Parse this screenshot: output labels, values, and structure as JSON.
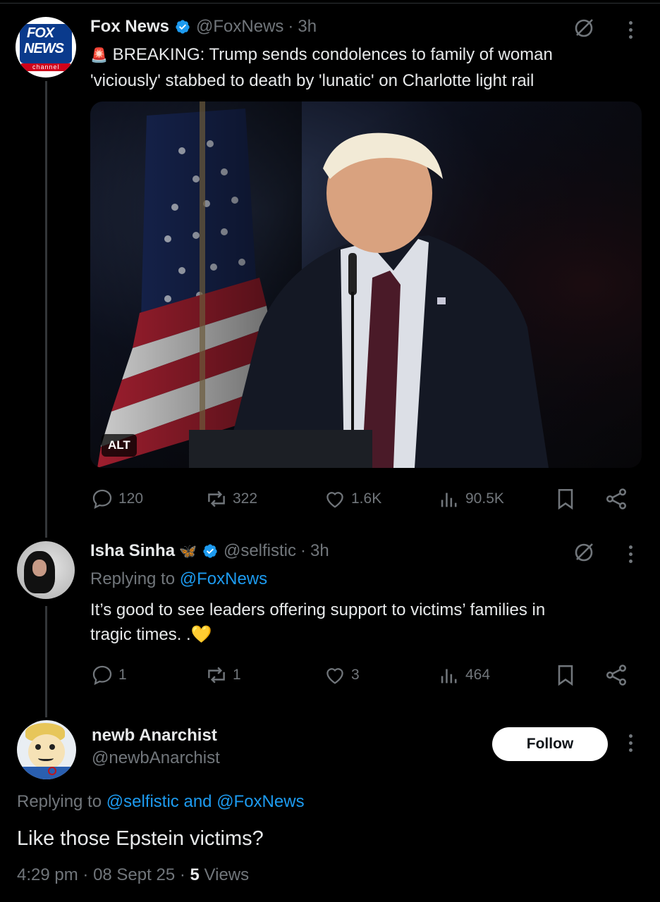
{
  "tweet1": {
    "author_name": "Fox News",
    "handle": "@FoxNews",
    "time": "3h",
    "siren": "🚨",
    "text": "BREAKING: Trump sends condolences to family of woman 'viciously' stabbed to death by 'lunatic' on Charlotte light rail",
    "logo": {
      "line1": "FOX",
      "line2": "NEWS",
      "line3": "channel"
    },
    "image_alt_badge": "ALT",
    "stats": {
      "replies": "120",
      "reposts": "322",
      "likes": "1.6K",
      "views": "90.5K"
    }
  },
  "tweet2": {
    "author_name": "Isha Sinha",
    "emoji": "🦋",
    "handle": "@selfistic",
    "time": "3h",
    "replying_prefix": "Replying to",
    "replying_to": "@FoxNews",
    "text_line1": "It’s good to see leaders offering support to victims’ families in",
    "text_line2": "tragic times. .💛",
    "stats": {
      "replies": "1",
      "reposts": "1",
      "likes": "3",
      "views": "464"
    }
  },
  "tweet3": {
    "author_name": "newb Anarchist",
    "handle": "@newbAnarchist",
    "follow_label": "Follow",
    "replying_prefix": "Replying to",
    "replying_to_1": "@selfistic",
    "replying_and": "and",
    "replying_to_2": "@FoxNews",
    "text": "Like those Epstein victims?",
    "time": "4:29 pm",
    "date": "08 Sept 25",
    "views_count": "5",
    "views_label": "Views"
  },
  "colors": {
    "background": "#000000",
    "text": "#e7e9ea",
    "muted": "#71767b",
    "link": "#1d9bf0",
    "verified": "#1d9bf0"
  },
  "icons": [
    "reply-icon",
    "repost-icon",
    "like-icon",
    "views-icon",
    "bookmark-icon",
    "share-icon",
    "grok-icon",
    "more-icon",
    "verified-icon"
  ]
}
